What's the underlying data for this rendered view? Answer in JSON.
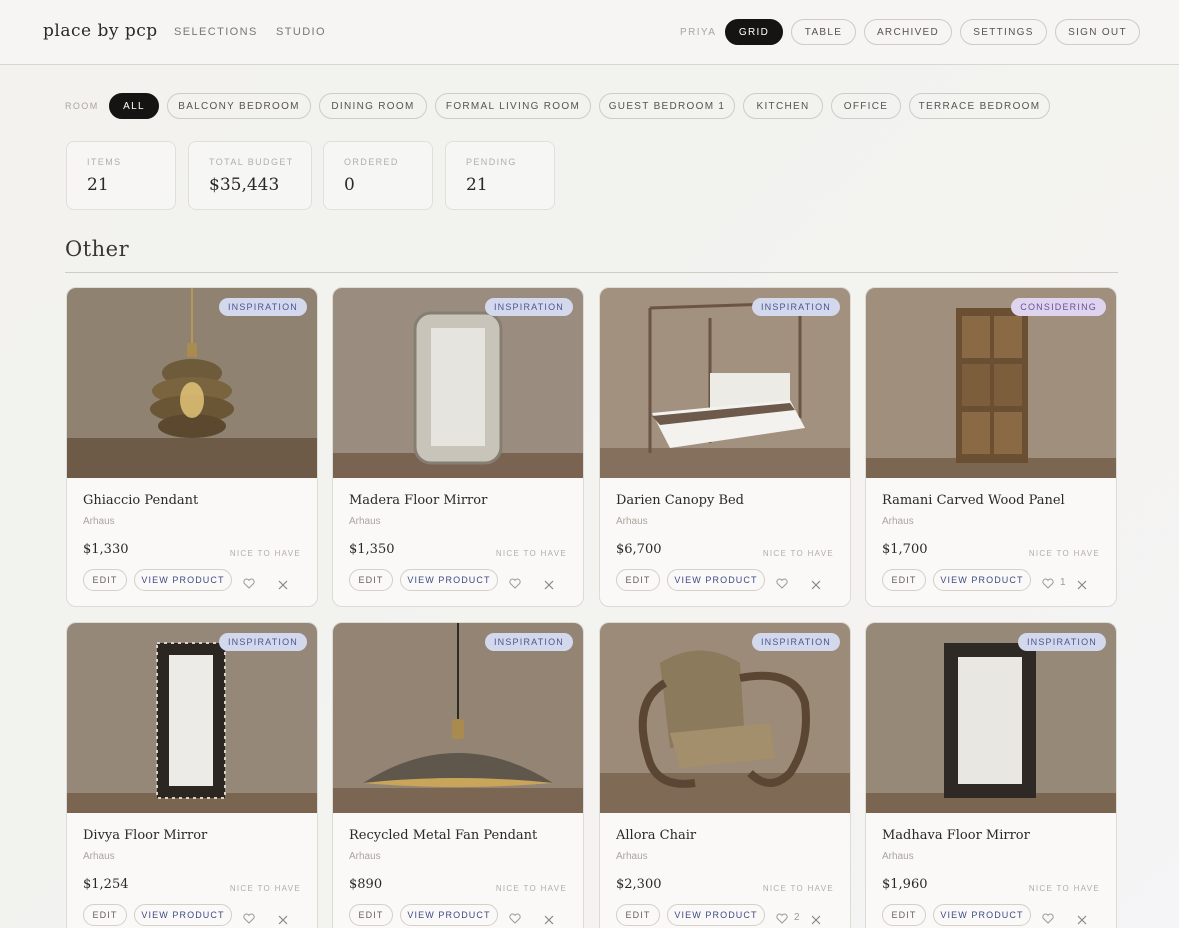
{
  "header": {
    "logo": "place by pcp",
    "nav": [
      "SELECTIONS",
      "STUDIO"
    ],
    "user": "PRIYA",
    "view_buttons": [
      "GRID",
      "TABLE",
      "ARCHIVED"
    ],
    "settings": "SETTINGS",
    "sign_out": "SIGN OUT",
    "active_view": "GRID"
  },
  "room_filter": {
    "label": "ROOM",
    "options": [
      "ALL",
      "BALCONY BEDROOM",
      "DINING ROOM",
      "FORMAL LIVING ROOM",
      "GUEST BEDROOM 1",
      "KITCHEN",
      "OFFICE",
      "TERRACE BEDROOM"
    ],
    "selected": "ALL"
  },
  "stats": [
    {
      "label": "ITEMS",
      "value": "21"
    },
    {
      "label": "TOTAL BUDGET",
      "value": "$35,443"
    },
    {
      "label": "ORDERED",
      "value": "0"
    },
    {
      "label": "PENDING",
      "value": "21"
    }
  ],
  "section": {
    "title": "Other"
  },
  "card_actions": {
    "edit": "EDIT",
    "view": "VIEW PRODUCT"
  },
  "products": [
    {
      "name": "Ghiaccio Pendant",
      "brand": "Arhaus",
      "price": "$1,330",
      "priority": "NICE TO HAVE",
      "status": "INSPIRATION",
      "likes": "",
      "image": "pendant-light"
    },
    {
      "name": "Madera Floor Mirror",
      "brand": "Arhaus",
      "price": "$1,350",
      "priority": "NICE TO HAVE",
      "status": "INSPIRATION",
      "likes": "",
      "image": "floor-mirror"
    },
    {
      "name": "Darien Canopy Bed",
      "brand": "Arhaus",
      "price": "$6,700",
      "priority": "NICE TO HAVE",
      "status": "INSPIRATION",
      "likes": "",
      "image": "canopy-bed"
    },
    {
      "name": "Ramani Carved Wood Panel",
      "brand": "Arhaus",
      "price": "$1,700",
      "priority": "NICE TO HAVE",
      "status": "CONSIDERING",
      "likes": "1",
      "image": "carved-panel"
    },
    {
      "name": "Divya Floor Mirror",
      "brand": "Arhaus",
      "price": "$1,254",
      "priority": "NICE TO HAVE",
      "status": "INSPIRATION",
      "likes": "",
      "image": "floor-mirror"
    },
    {
      "name": "Recycled Metal Fan Pendant",
      "brand": "Arhaus",
      "price": "$890",
      "priority": "NICE TO HAVE",
      "status": "INSPIRATION",
      "likes": "",
      "image": "fan-pendant"
    },
    {
      "name": "Allora Chair",
      "brand": "Arhaus",
      "price": "$2,300",
      "priority": "NICE TO HAVE",
      "status": "INSPIRATION",
      "likes": "2",
      "image": "lounge-chair"
    },
    {
      "name": "Madhava Floor Mirror",
      "brand": "Arhaus",
      "price": "$1,960",
      "priority": "NICE TO HAVE",
      "status": "INSPIRATION",
      "likes": "",
      "image": "floor-mirror"
    }
  ],
  "colors": {
    "accent_dark": "#151412",
    "inspiration_badge": "#d3d8ec",
    "considering_badge": "#ded4ee",
    "link_blue": "#3d4a86"
  }
}
